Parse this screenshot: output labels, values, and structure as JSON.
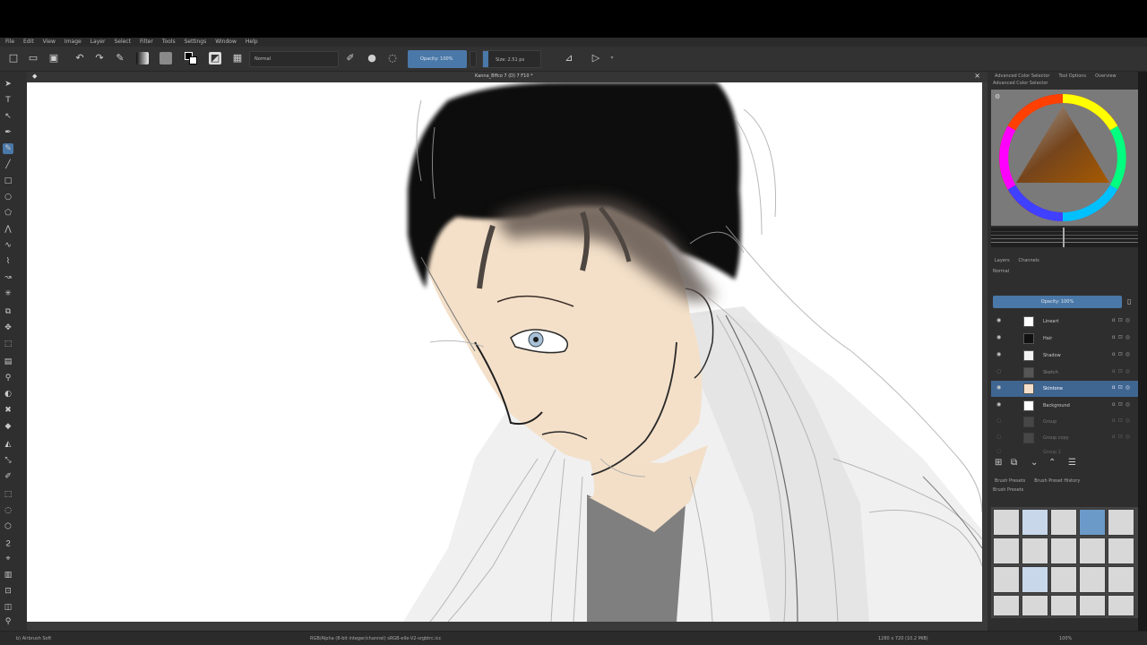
{
  "menu": [
    "File",
    "Edit",
    "View",
    "Image",
    "Layer",
    "Select",
    "Filter",
    "Tools",
    "Settings",
    "Window",
    "Help"
  ],
  "toolbar": {
    "blend_mode": "Normal",
    "opacity_label": "Opacity: 100%",
    "opacity": 1.0,
    "size_label": "Size: 2.51 px"
  },
  "document": {
    "title": "Kanna_Bffco 7 (D) 7 F10 *"
  },
  "dock": {
    "color_tabs": [
      "Advanced Color Selector",
      "Tool Options",
      "Overview"
    ],
    "color_panel_label": "Advanced Color Selector",
    "layers_tabs": [
      "Layers",
      "Channels"
    ],
    "blend_label": "Normal",
    "opacity_bar_label": "Opacity: 100%",
    "layers": [
      {
        "name": "Lineart",
        "active": false,
        "visible": true
      },
      {
        "name": "Hair",
        "active": false,
        "visible": true
      },
      {
        "name": "Shadow",
        "active": false,
        "visible": true
      },
      {
        "name": "Sketch",
        "active": false,
        "visible": false
      },
      {
        "name": "Skintone",
        "active": true,
        "visible": true
      },
      {
        "name": "Background",
        "active": false,
        "visible": true
      },
      {
        "name": "Group",
        "active": false,
        "visible": false
      },
      {
        "name": "Group copy",
        "active": false,
        "visible": false
      },
      {
        "name": "Group 2",
        "active": false,
        "visible": false
      }
    ],
    "brush_tabs": [
      "Brush Presets",
      "Brush Preset History"
    ],
    "brush_label": "Brush Presets"
  },
  "status": {
    "left": "b) Airbrush Soft",
    "center": "RGB/Alpha (8-bit integer/channel)  sRGB-elle-V2-srgbtrc.icc",
    "right": "1280 x 720 (10.2 MiB)",
    "zoom": "100%"
  },
  "colors": {
    "fg": "#000000",
    "bg": "#ffffff",
    "accent": "#4a78a8",
    "skin": "#f3dfc8",
    "hair": "#0a0a0a"
  }
}
